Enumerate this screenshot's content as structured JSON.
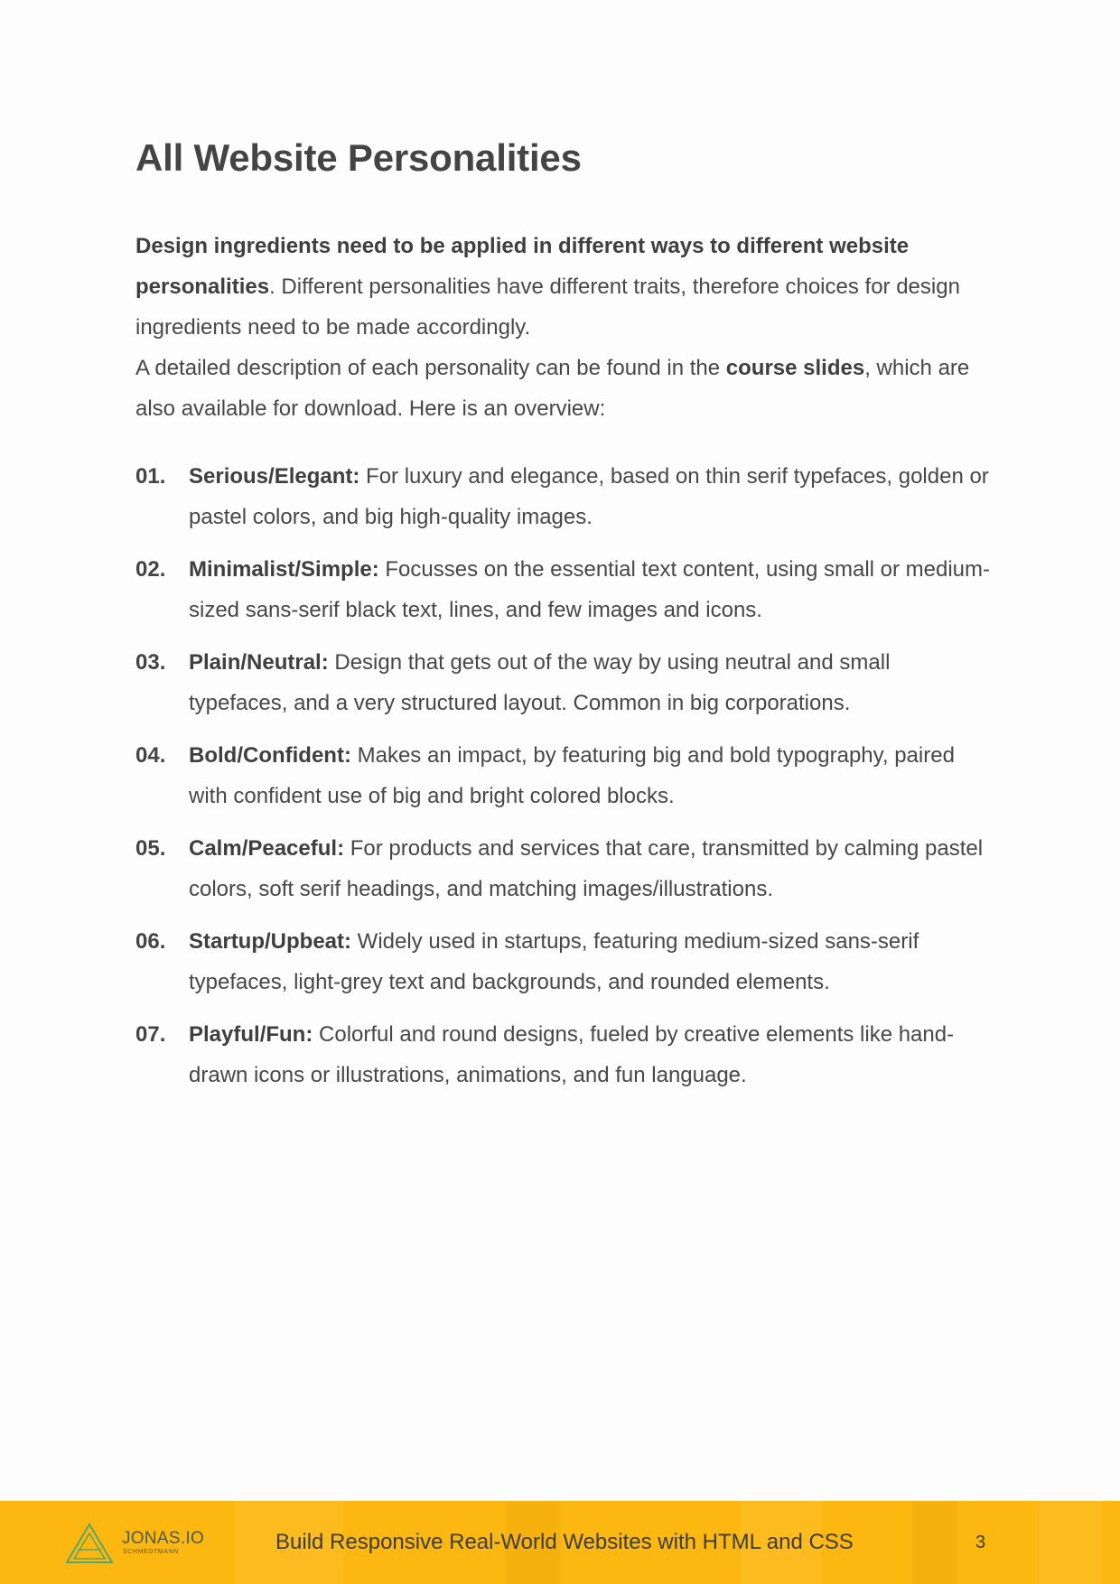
{
  "title": "All Website Personalities",
  "intro": {
    "p1_bold": "Design ingredients need to be applied in different ways to different website personalities",
    "p1_rest": ". Different personalities have different traits, therefore choices for design ingredients need to be made accordingly.",
    "p2_start": "A detailed description of each personality can be found in the ",
    "p2_bold": "course slides",
    "p2_rest": ", which are also available for download. Here is an overview:"
  },
  "personalities": [
    {
      "num": "01.",
      "term": "Serious/Elegant:",
      "desc": " For luxury and elegance, based on thin serif typefaces, golden or pastel colors, and big high-quality images."
    },
    {
      "num": "02.",
      "term": "Minimalist/Simple:",
      "desc": " Focusses on the essential text content, using small or medium-sized sans-serif black text, lines, and few images and icons."
    },
    {
      "num": "03.",
      "term": "Plain/Neutral:",
      "desc": " Design that gets out of the way by using neutral and small typefaces, and a very structured layout. Common in big corporations."
    },
    {
      "num": "04.",
      "term": "Bold/Confident:",
      "desc": " Makes an impact, by featuring big and bold typography, paired with confident use of big and bright colored blocks."
    },
    {
      "num": "05.",
      "term": "Calm/Peaceful:",
      "desc": " For products and services that care, transmitted by calming pastel colors, soft serif headings, and matching images/illustrations."
    },
    {
      "num": "06.",
      "term": "Startup/Upbeat:",
      "desc": " Widely used in startups, featuring medium-sized sans-serif typefaces, light-grey text and backgrounds, and rounded elements."
    },
    {
      "num": "07.",
      "term": "Playful/Fun:",
      "desc": " Colorful and round designs, fueled by creative elements like hand-drawn icons or illustrations, animations, and fun language."
    }
  ],
  "footer": {
    "logo_name": "JONAS.IO",
    "logo_sub": "SCHMEDTMANN",
    "title": "Build Responsive Real-World Websites with HTML and CSS",
    "page_number": "3",
    "colors": {
      "band": "#fcb710",
      "logo": "#5aa56a"
    }
  }
}
